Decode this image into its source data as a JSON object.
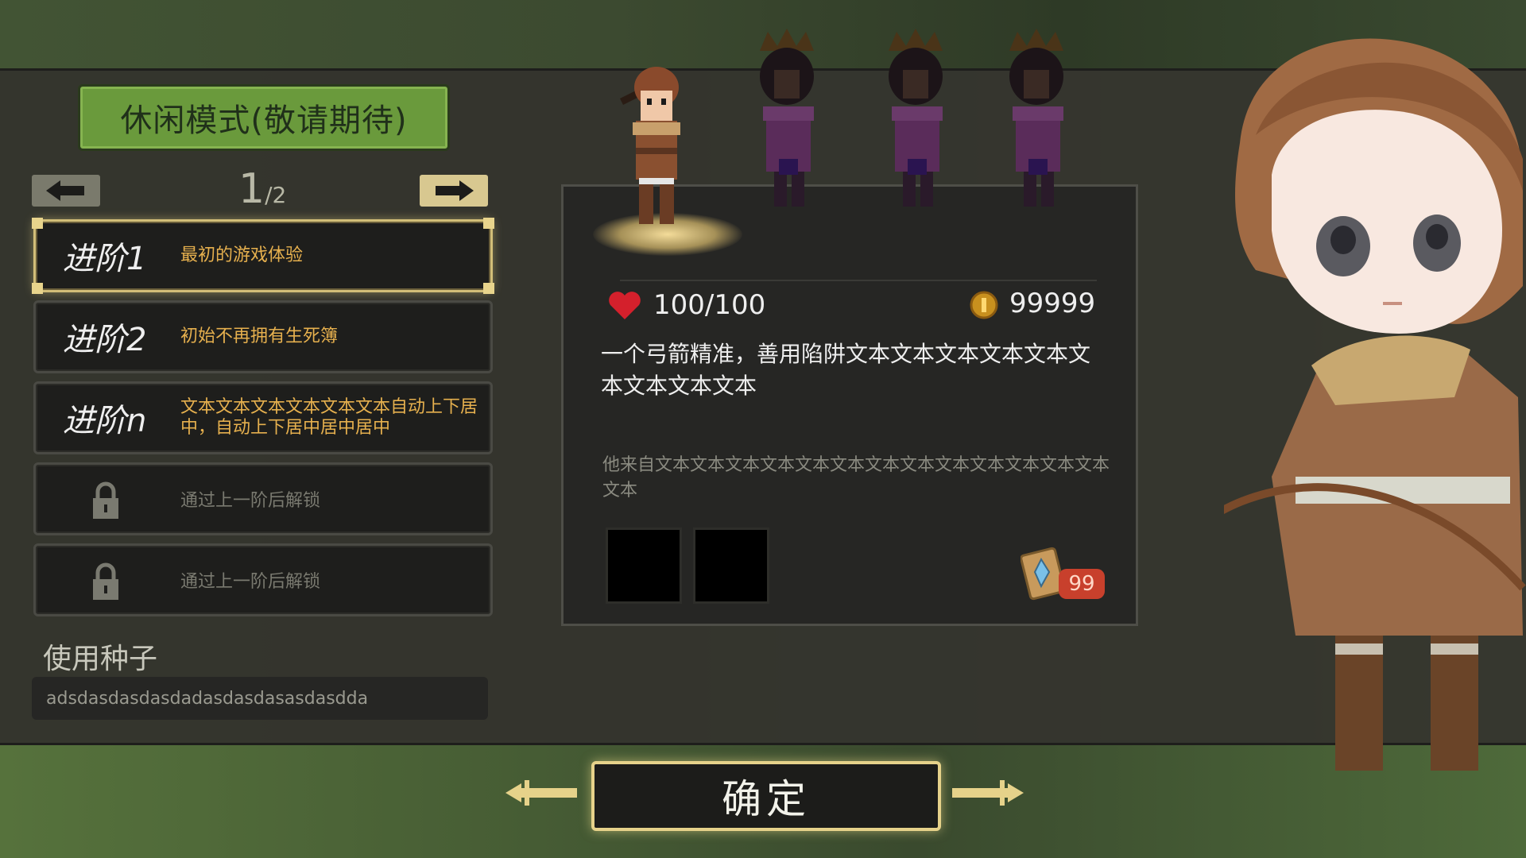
{
  "mode_banner": "休闲模式(敬请期待)",
  "pagination": {
    "current": "1",
    "total": "/2",
    "prev_icon": "arrow-left-icon",
    "next_icon": "arrow-right-icon"
  },
  "levels": [
    {
      "title": "进阶1",
      "desc": "最初的游戏体验",
      "selected": true
    },
    {
      "title": "进阶2",
      "desc": "初始不再拥有生死簿"
    },
    {
      "title": "进阶n",
      "desc": "文本文本文本文本文本文本自动上下居中，自动上下居中居中居中"
    },
    {
      "locked": true,
      "desc": "通过上一阶后解锁"
    },
    {
      "locked": true,
      "desc": "通过上一阶后解锁"
    }
  ],
  "seed": {
    "label": "使用种子",
    "value": "adsdasdasdasdadasdasdasasdasdda"
  },
  "character": {
    "hp": "100/100",
    "coins": "99999",
    "description": "一个弓箭精准，善用陷阱文本文本文本文本文本文本文本文本文本",
    "background": "他来自文本文本文本文本文本文本文本文本文本文本文本文本文本文本",
    "item_count": "99"
  },
  "colors": {
    "accent_gold": "#e6d28a",
    "mode_green": "#6a9a3c",
    "desc_orange": "#e6b04e",
    "badge_red": "#c8402c"
  },
  "confirm_label": "确定"
}
